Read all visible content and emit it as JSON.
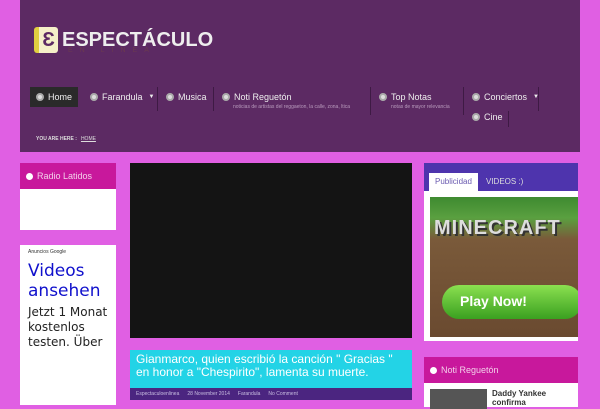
{
  "logo": {
    "title": "ESPECTÁCULO",
    "subtitle": "EN LINEA"
  },
  "nav": [
    {
      "label": "Home",
      "active": true
    },
    {
      "label": "Farandula",
      "dropdown": true
    },
    {
      "label": "Musica"
    },
    {
      "label": "Noti Reguetón",
      "sub": "noticias de artistas del reggaeton, la calle, zona, ltica"
    },
    {
      "label": "Top Notas",
      "sub": "notas de mayor relevancia"
    },
    {
      "label": "Conciertos",
      "dropdown": true
    },
    {
      "label": "Cine"
    }
  ],
  "breadcrumb": {
    "prefix": "YOU ARE HERE :",
    "current": "HOME"
  },
  "left": {
    "radio_title": "Radio Latidos",
    "ads_label": "Anuncios Google",
    "ad_title": "Videos ansehen",
    "ad_text": "Jetzt 1 Monat kostenlos testen. Über"
  },
  "post": {
    "title": "Gianmarco, quien escribió la canción \" Gracias \" en honor a \"Chespirito\", lamenta su muerte.",
    "author": "Espectaculoenlinea",
    "date": "28 November 2014",
    "category": "Farandula",
    "comments": "No Comment"
  },
  "right": {
    "tabs": [
      "Publicidad",
      "VIDEOS :)"
    ],
    "ad_game": "MINECRAFT",
    "ad_button": "Play Now!",
    "widget_title": "Noti Reguetón",
    "news_item": "Daddy Yankee confirma"
  }
}
